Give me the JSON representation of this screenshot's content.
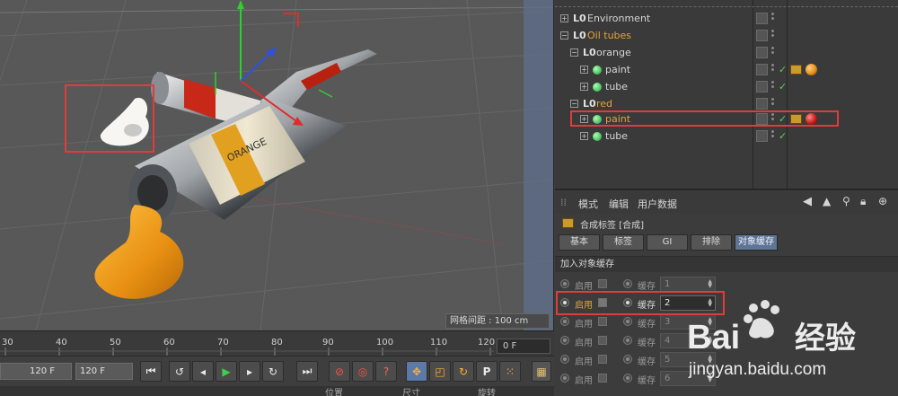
{
  "viewport": {
    "grid_spacing": "网格间距 : 100 cm"
  },
  "timeline": {
    "ticks": [
      "30",
      "40",
      "50",
      "60",
      "70",
      "80",
      "90",
      "100",
      "110",
      "120"
    ],
    "current_frame": "0 F"
  },
  "transport": {
    "end_frame_1": "120 F",
    "end_frame_2": "120 F"
  },
  "bottom_strip": {
    "labels": [
      "位置",
      "尺寸",
      "旋转"
    ]
  },
  "object_manager": {
    "rows": [
      {
        "label": "Environment",
        "kind": "null"
      },
      {
        "label": "Oil tubes",
        "kind": "null"
      },
      {
        "label": "orange",
        "kind": "null"
      },
      {
        "label": "paint",
        "kind": "object"
      },
      {
        "label": "tube",
        "kind": "object"
      },
      {
        "label": "red",
        "kind": "null"
      },
      {
        "label": "paint",
        "kind": "object"
      },
      {
        "label": "tube",
        "kind": "object"
      }
    ],
    "ball_colors": [
      "#e8901c",
      "#cc1c1c"
    ]
  },
  "attributes": {
    "menu": [
      "模式",
      "编辑",
      "用户数据"
    ],
    "tag_title": "合成标签 [合成]",
    "tabs": [
      "基本",
      "标签",
      "GI",
      "排除",
      "对象缓存"
    ],
    "section_title": "加入对象缓存",
    "enable_label": "启用",
    "buffer_label": "缓存",
    "buffers": [
      "1",
      "2",
      "3",
      "4",
      "5",
      "6"
    ]
  },
  "watermark": {
    "brand_left": "Bai",
    "brand_right": "经验",
    "url": "jingyan.baidu.com"
  },
  "colors": {
    "highlight": "#e03c3c",
    "selected_text": "#e5a23a",
    "active_tab": "#5f7596"
  }
}
